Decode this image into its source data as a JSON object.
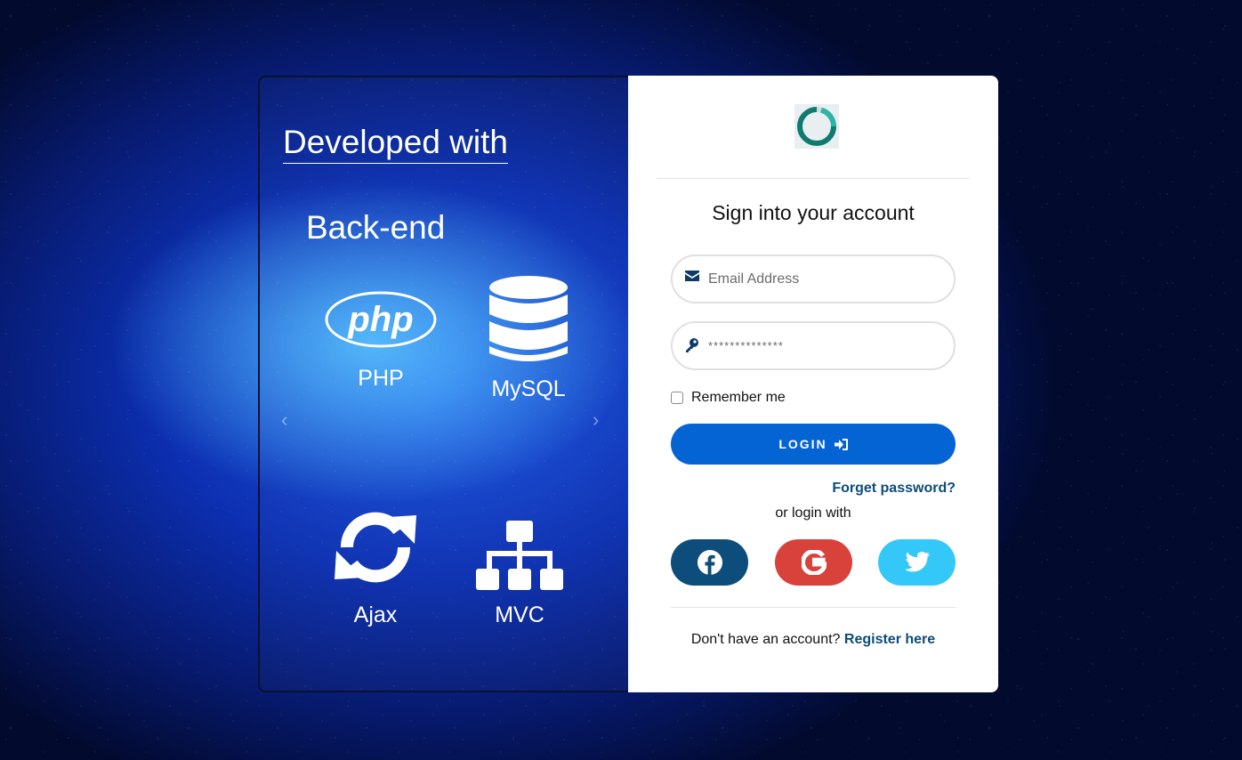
{
  "showcase": {
    "title": "Developed with",
    "section": "Back-end",
    "technologies": [
      {
        "label": "PHP",
        "icon": "php-logo-icon",
        "logo_text": "php"
      },
      {
        "label": "MySQL",
        "icon": "database-icon"
      },
      {
        "label": "Ajax",
        "icon": "sync-arrows-icon"
      },
      {
        "label": "MVC",
        "icon": "sitemap-icon"
      }
    ],
    "prev_arrow": "‹",
    "next_arrow": "›"
  },
  "login": {
    "title": "Sign into your account",
    "email": {
      "placeholder": "Email Address",
      "value": "",
      "icon": "envelope-icon"
    },
    "password": {
      "placeholder": "**************",
      "value": "",
      "icon": "key-icon"
    },
    "remember_label": "Remember me",
    "remember_checked": false,
    "login_button": "LOGIN",
    "login_icon": "sign-in-icon",
    "forgot_label": "Forget password?",
    "or_text": "or login with",
    "social": [
      {
        "name": "facebook",
        "icon": "facebook-icon",
        "color": "#0c4d7c"
      },
      {
        "name": "google",
        "icon": "google-icon",
        "color": "#d9423a"
      },
      {
        "name": "twitter",
        "icon": "twitter-icon",
        "color": "#33c8f8"
      }
    ],
    "register_prompt": "Don't have an account?",
    "register_link": "Register here"
  },
  "colors": {
    "primary": "#0564d4",
    "link": "#0d4b7a",
    "background": "#0c2fb0"
  }
}
